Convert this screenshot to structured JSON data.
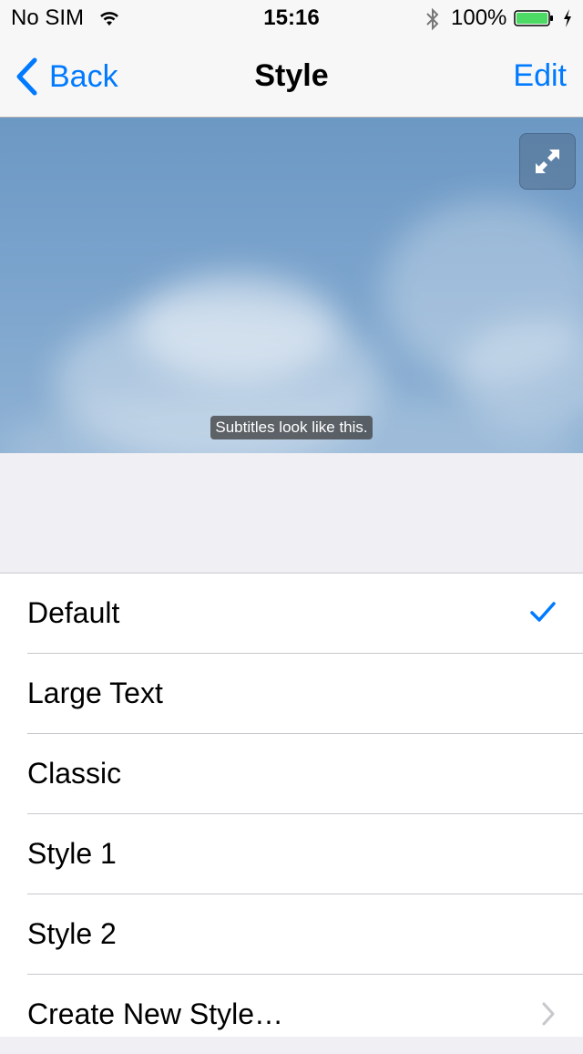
{
  "status_bar": {
    "carrier": "No SIM",
    "time": "15:16",
    "battery_percent": "100%",
    "battery_level": 1.0,
    "icons": [
      "wifi-icon",
      "bluetooth-icon",
      "battery-icon",
      "charging-bolt-icon"
    ]
  },
  "nav": {
    "back_label": "Back",
    "title": "Style",
    "edit_label": "Edit",
    "accent": "#007aff"
  },
  "preview": {
    "subtitle_text": "Subtitles look like this.",
    "expand_icon": "expand-icon"
  },
  "styles": {
    "items": [
      {
        "label": "Default",
        "selected": true
      },
      {
        "label": "Large Text",
        "selected": false
      },
      {
        "label": "Classic",
        "selected": false
      },
      {
        "label": "Style 1",
        "selected": false
      },
      {
        "label": "Style 2",
        "selected": false
      },
      {
        "label": "Create New Style…",
        "selected": false,
        "disclosure": true
      }
    ]
  }
}
